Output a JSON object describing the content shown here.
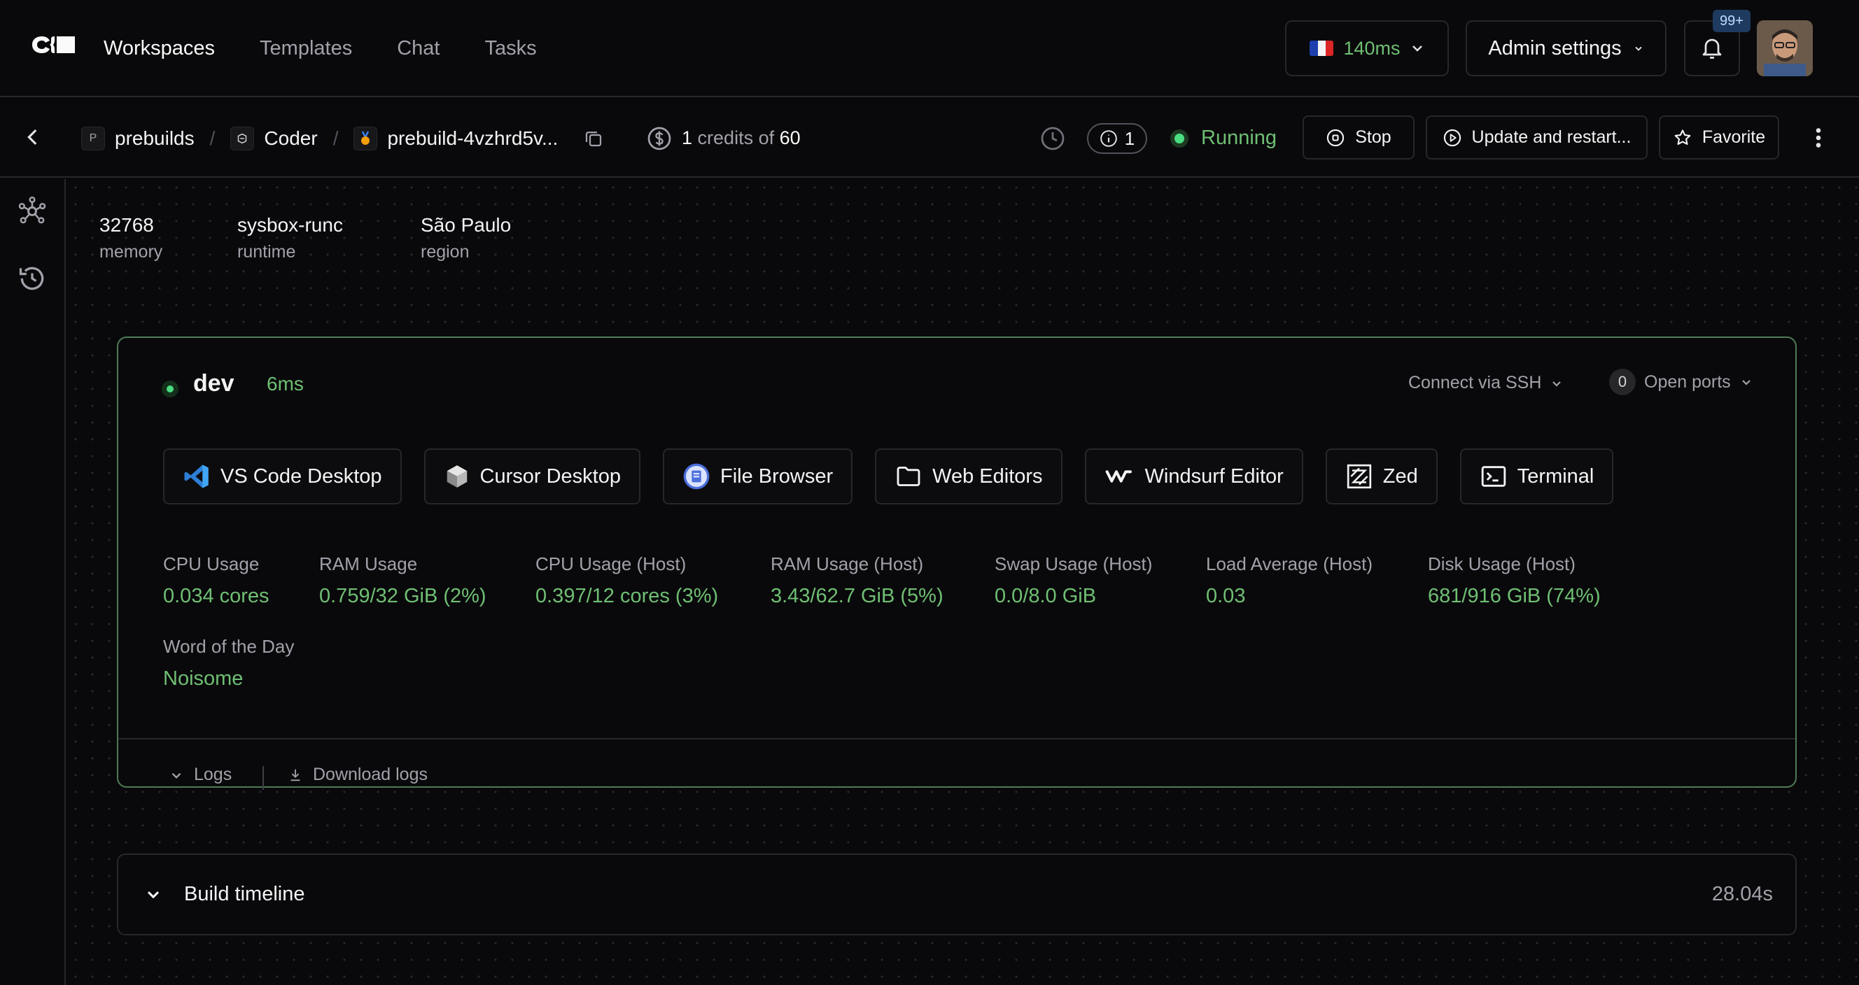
{
  "nav": {
    "links": [
      "Workspaces",
      "Templates",
      "Chat",
      "Tasks"
    ],
    "latency": "140ms",
    "admin_settings": "Admin settings",
    "notifications_badge": "99+"
  },
  "subheader": {
    "breadcrumb": {
      "org_initial": "P",
      "org": "prebuilds",
      "template": "Coder",
      "workspace": "prebuild-4vzhrd5v..."
    },
    "credits": {
      "used": "1",
      "middle": "credits of",
      "total": "60"
    },
    "info_count": "1",
    "status": "Running",
    "stop_label": "Stop",
    "update_label": "Update and restart...",
    "favorite_label": "Favorite"
  },
  "meta": [
    {
      "value": "32768",
      "key": "memory"
    },
    {
      "value": "sysbox-runc",
      "key": "runtime"
    },
    {
      "value": "São Paulo",
      "key": "region"
    }
  ],
  "agent": {
    "name": "dev",
    "latency": "6ms",
    "ssh_label": "Connect via SSH",
    "ports_count": "0",
    "ports_label": "Open ports",
    "apps": [
      "VS Code Desktop",
      "Cursor Desktop",
      "File Browser",
      "Web Editors",
      "Windsurf Editor",
      "Zed",
      "Terminal"
    ],
    "stats": [
      {
        "label": "CPU Usage",
        "value": "0.034 cores"
      },
      {
        "label": "RAM Usage",
        "value": "0.759/32 GiB (2%)"
      },
      {
        "label": "CPU Usage (Host)",
        "value": "0.397/12 cores (3%)"
      },
      {
        "label": "RAM Usage (Host)",
        "value": "3.43/62.7 GiB (5%)"
      },
      {
        "label": "Swap Usage (Host)",
        "value": "0.0/8.0 GiB"
      },
      {
        "label": "Load Average (Host)",
        "value": "0.03"
      },
      {
        "label": "Disk Usage (Host)",
        "value": "681/916 GiB (74%)"
      },
      {
        "label": "Word of the Day",
        "value": "Noisome"
      }
    ],
    "logs_label": "Logs",
    "download_logs_label": "Download logs"
  },
  "timeline": {
    "title": "Build timeline",
    "duration": "28.04s"
  },
  "colors": {
    "background": "#09090b",
    "border": "#27272a",
    "running_green": "#6fbf73",
    "agent_border": "#4d7c55",
    "muted_text": "#a1a1aa"
  }
}
